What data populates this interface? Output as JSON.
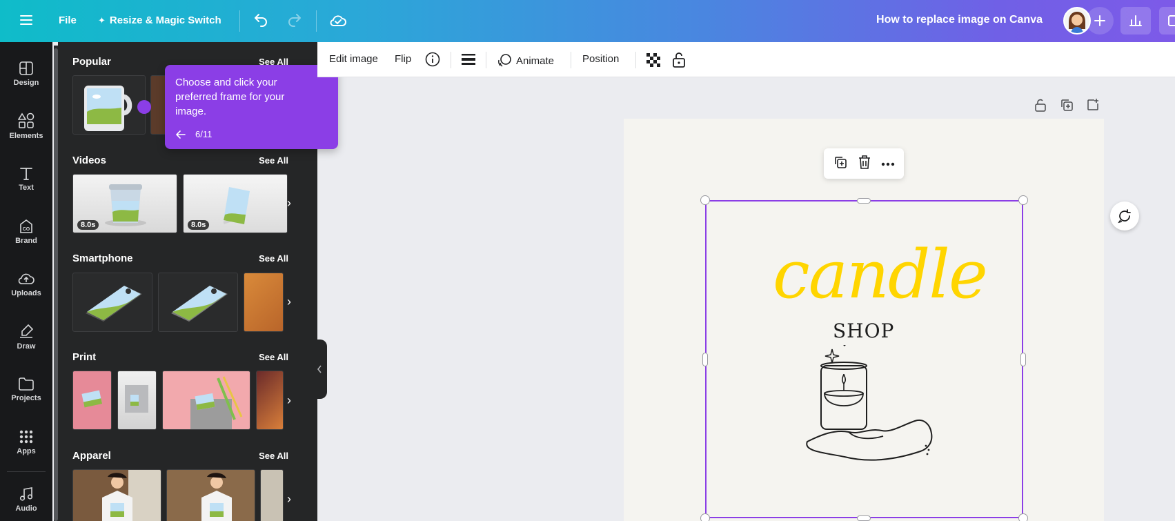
{
  "topbar": {
    "file_label": "File",
    "resize_label": "Resize & Magic Switch",
    "doc_title": "How to replace image on Canva"
  },
  "rail": {
    "items": [
      {
        "label": "Design",
        "icon": "design-icon"
      },
      {
        "label": "Elements",
        "icon": "elements-icon"
      },
      {
        "label": "Text",
        "icon": "text-icon"
      },
      {
        "label": "Brand",
        "icon": "brand-icon"
      },
      {
        "label": "Uploads",
        "icon": "uploads-icon"
      },
      {
        "label": "Draw",
        "icon": "draw-icon"
      },
      {
        "label": "Projects",
        "icon": "projects-icon"
      },
      {
        "label": "Apps",
        "icon": "apps-icon"
      },
      {
        "label": "Audio",
        "icon": "audio-icon"
      }
    ]
  },
  "panel": {
    "sections": [
      {
        "title": "Popular",
        "see_all": "See All"
      },
      {
        "title": "Videos",
        "see_all": "See All",
        "durations": [
          "8.0s",
          "8.0s"
        ]
      },
      {
        "title": "Smartphone",
        "see_all": "See All"
      },
      {
        "title": "Print",
        "see_all": "See All"
      },
      {
        "title": "Apparel",
        "see_all": "See All"
      }
    ]
  },
  "tooltip": {
    "text": "Choose and click your preferred frame for your image.",
    "step": "6/11"
  },
  "context_toolbar": {
    "edit_image": "Edit image",
    "flip": "Flip",
    "animate": "Animate",
    "position": "Position"
  },
  "canvas": {
    "logo_word": "candle",
    "logo_sub": "SHOP"
  },
  "colors": {
    "accent": "#8b3ee6",
    "logo_yellow": "#ffd500",
    "sidebar_bg": "#18191b",
    "panel_bg": "#252627"
  }
}
